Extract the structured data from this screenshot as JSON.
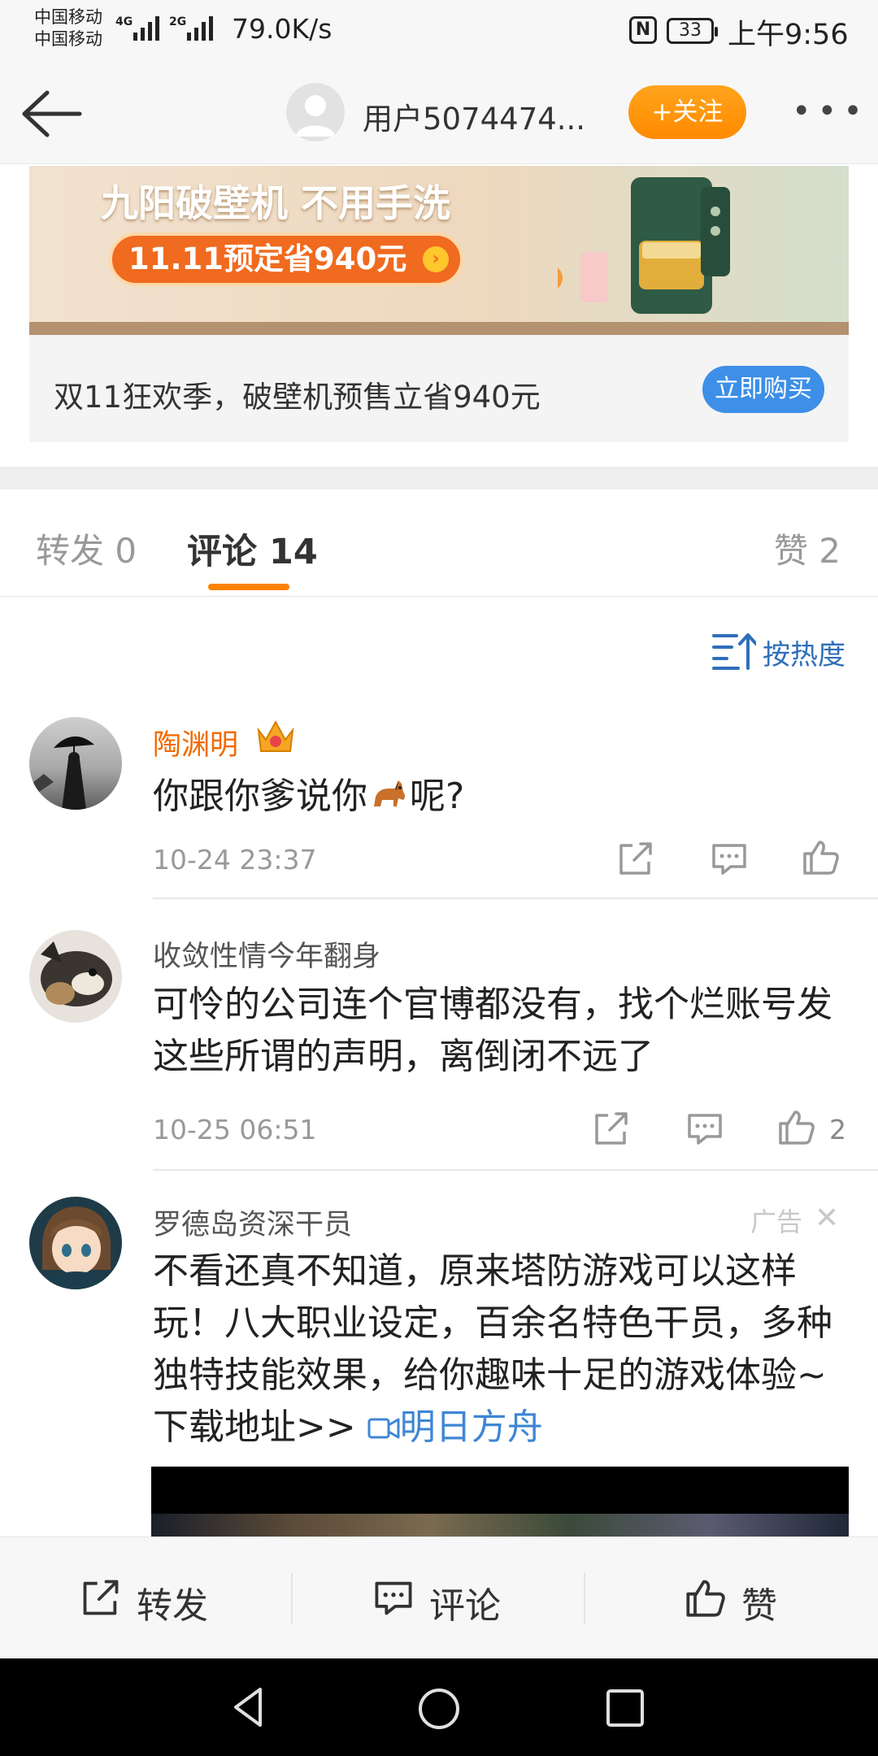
{
  "status_bar": {
    "carrier_1": "中国移动",
    "carrier_2": "中国移动",
    "network_1": "4G",
    "network_2": "2G",
    "net_speed": "79.0K/s",
    "nfc": "N",
    "battery": "33",
    "time": "上午9:56"
  },
  "header": {
    "back_icon": "back-arrow-icon",
    "username": "用户5074474...",
    "follow_label": "+关注",
    "more_icon": "more-dots-icon"
  },
  "ad_banner": {
    "headline": "九阳破壁机 不用手洗",
    "promo": "11.11预定省940元",
    "caption": "双11狂欢季，破壁机预售立省940元",
    "buy_label": "立即购买"
  },
  "tabs": {
    "repost": "转发 0",
    "comment": "评论 14",
    "like": "赞 2"
  },
  "sort": {
    "icon": "sort-icon",
    "label": "按热度"
  },
  "comments": [
    {
      "name": "陶渊明",
      "badge_icon": "vip-crown-icon",
      "text_before": "你跟你爹说你",
      "emoji_icon": "horse-emoji-icon",
      "text_after": "呢?",
      "time": "10-24 23:37",
      "likes": ""
    },
    {
      "name": "收敛性情今年翻身",
      "text": "可怜的公司连个官博都没有，找个烂账号发这些所谓的声明，离倒闭不远了",
      "time": "10-25 06:51",
      "likes": "2"
    },
    {
      "name": "罗德岛资深干员",
      "ad_tag": "广告",
      "text": "不看还真不知道，原来塔防游戏可以这样玩！八大职业设定，百余名特色干员，多种独特技能效果，给你趣味十足的游戏体验~下载地址>> ",
      "app_link": "明日方舟"
    }
  ],
  "toolbar": {
    "repost": "转发",
    "comment": "评论",
    "like": "赞"
  },
  "colors": {
    "accent_orange": "#ff8200",
    "link_blue": "#3f86d4",
    "sort_blue": "#2f6fba",
    "buy_button_blue": "#3d8fe8"
  }
}
